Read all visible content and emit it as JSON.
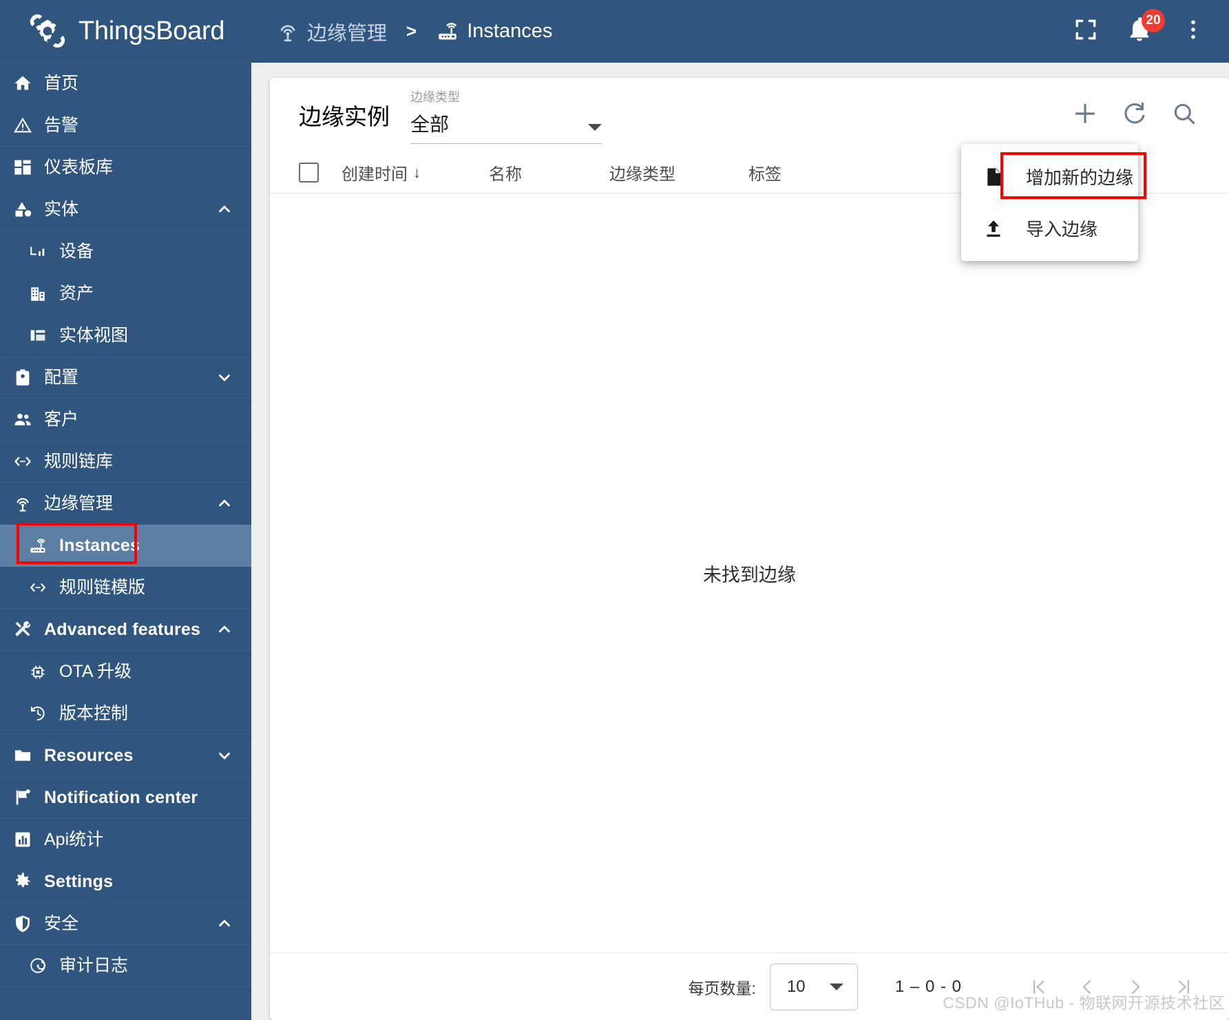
{
  "brand": {
    "name": "ThingsBoard",
    "logo_icon": "thingsboard-logo-icon"
  },
  "colors": {
    "sidebar_bg": "#305680",
    "sidebar_active": "#5c7fa3",
    "topbar_bg": "#305680",
    "highlight_red": "#ff0000",
    "badge_red": "#f03c30",
    "page_bg": "#eeeeee"
  },
  "sidebar": {
    "items": [
      {
        "label": "首页",
        "icon": "home-icon",
        "level": "top",
        "expandable": false,
        "active": false
      },
      {
        "label": "告警",
        "icon": "alarm-warning-icon",
        "level": "top",
        "expandable": false,
        "active": false
      },
      {
        "label": "仪表板库",
        "icon": "dashboard-icon",
        "level": "top",
        "expandable": false,
        "active": false
      },
      {
        "label": "实体",
        "icon": "entities-icon",
        "level": "top",
        "expandable": true,
        "expanded": true,
        "active": false
      },
      {
        "label": "设备",
        "icon": "device-icon",
        "level": "sub",
        "expandable": false,
        "active": false
      },
      {
        "label": "资产",
        "icon": "asset-building-icon",
        "level": "sub",
        "expandable": false,
        "active": false
      },
      {
        "label": "实体视图",
        "icon": "entity-view-icon",
        "level": "sub",
        "expandable": false,
        "active": false
      },
      {
        "label": "配置",
        "icon": "profile-config-icon",
        "level": "top",
        "expandable": true,
        "expanded": false,
        "active": false
      },
      {
        "label": "客户",
        "icon": "customers-icon",
        "level": "top",
        "expandable": false,
        "active": false
      },
      {
        "label": "规则链库",
        "icon": "rule-chain-icon",
        "level": "top",
        "expandable": false,
        "active": false
      },
      {
        "label": "边缘管理",
        "icon": "edge-antenna-icon",
        "level": "top",
        "expandable": true,
        "expanded": true,
        "active": false
      },
      {
        "label": "Instances",
        "icon": "router-icon",
        "level": "sub",
        "expandable": false,
        "active": true,
        "highlighted": true
      },
      {
        "label": "规则链模版",
        "icon": "rule-chain-icon",
        "level": "sub",
        "expandable": false,
        "active": false
      },
      {
        "label": "Advanced features",
        "icon": "tools-icon",
        "level": "top",
        "expandable": true,
        "expanded": true,
        "active": false
      },
      {
        "label": "OTA 升级",
        "icon": "chip-ota-icon",
        "level": "sub",
        "expandable": false,
        "active": false
      },
      {
        "label": "版本控制",
        "icon": "history-icon",
        "level": "sub",
        "expandable": false,
        "active": false
      },
      {
        "label": "Resources",
        "icon": "folder-icon",
        "level": "top",
        "expandable": true,
        "expanded": false,
        "active": false
      },
      {
        "label": "Notification center",
        "icon": "flag-notification-icon",
        "level": "top",
        "expandable": false,
        "active": false
      },
      {
        "label": "Api统计",
        "icon": "bar-chart-icon",
        "level": "top",
        "expandable": false,
        "active": false
      },
      {
        "label": "Settings",
        "icon": "gear-icon",
        "level": "top",
        "expandable": false,
        "active": false
      },
      {
        "label": "安全",
        "icon": "shield-icon",
        "level": "top",
        "expandable": true,
        "expanded": true,
        "active": false
      },
      {
        "label": "审计日志",
        "icon": "audit-log-icon",
        "level": "sub",
        "expandable": false,
        "active": false
      }
    ]
  },
  "topbar": {
    "breadcrumb": [
      {
        "label": "边缘管理",
        "icon": "edge-antenna-icon"
      },
      {
        "label": "Instances",
        "icon": "router-icon"
      }
    ],
    "separator": ">",
    "actions": [
      {
        "name": "fullscreen-icon",
        "label": ""
      },
      {
        "name": "notifications-bell-icon",
        "label": ""
      },
      {
        "name": "more-vertical-icon",
        "label": ""
      }
    ],
    "notification_badge": "20"
  },
  "card": {
    "title": "边缘实例",
    "filter": {
      "label": "边缘类型",
      "value": "全部",
      "options": [
        "全部"
      ]
    },
    "actions": [
      {
        "name": "add-button",
        "icon": "plus-icon"
      },
      {
        "name": "refresh-button",
        "icon": "refresh-icon"
      },
      {
        "name": "search-button",
        "icon": "search-icon"
      }
    ],
    "table": {
      "columns": [
        {
          "label": "创建时间",
          "sorted": true,
          "sort_dir": "desc",
          "sort_glyph": "↓"
        },
        {
          "label": "名称",
          "sorted": false
        },
        {
          "label": "边缘类型",
          "sorted": false
        },
        {
          "label": "标签",
          "sorted": false
        }
      ],
      "rows": [],
      "empty_message": "未找到边缘"
    },
    "pagination": {
      "per_page_label": "每页数量:",
      "per_page_value": "10",
      "range_text": "1 – 0 - 0",
      "first_glyph": "|‹",
      "prev_glyph": "‹",
      "next_glyph": "›",
      "last_glyph": "›|"
    }
  },
  "menu": {
    "items": [
      {
        "label": "增加新的边缘",
        "icon": "add-file-icon",
        "highlighted": true
      },
      {
        "label": "导入边缘",
        "icon": "upload-icon",
        "highlighted": false
      }
    ]
  },
  "watermark": {
    "text": "CSDN @IoTHub - 物联网开源技术社区"
  }
}
